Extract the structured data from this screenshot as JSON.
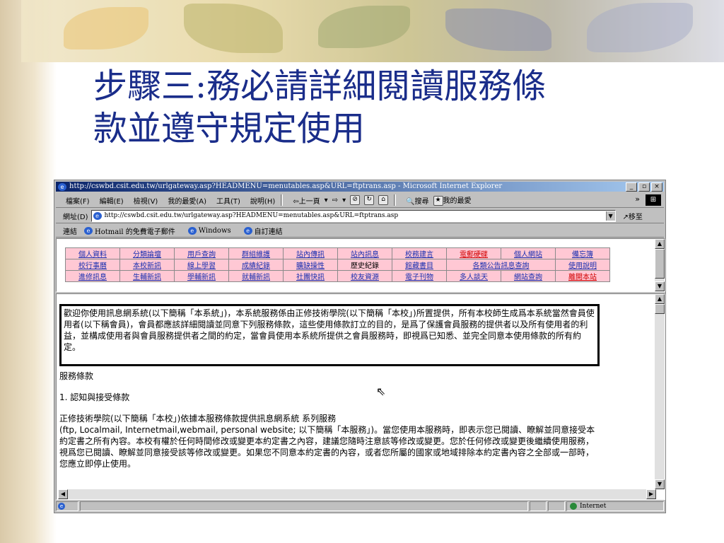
{
  "slide": {
    "title_line1": "步驟三:務必請詳細閱讀服務條",
    "title_line2": "款並遵守規定使用"
  },
  "browser": {
    "title": "http://cswbd.csit.edu.tw/urlgateway.asp?HEADMENU=menutables.asp&URL=ftptrans.asp - Microsoft Internet Explorer",
    "window_buttons": [
      "_",
      "▫",
      "×"
    ],
    "menu": [
      "檔案(F)",
      "編輯(E)",
      "檢視(V)",
      "我的最愛(A)",
      "工具(T)",
      "說明(H)"
    ],
    "toolbar": {
      "back": "⇦上一頁",
      "forward": "⇨",
      "search": "搜尋",
      "favorites": "我的最愛",
      "more": "»"
    },
    "address": {
      "label": "網址(D)",
      "url": "http://cswbd.csit.edu.tw/urlgateway.asp?HEADMENU=menutables.asp&URL=ftptrans.asp",
      "go": "移至"
    },
    "links": {
      "label": "連結",
      "items": [
        "Hotmail 的免費電子郵件",
        "Windows",
        "自訂連結"
      ]
    },
    "status": {
      "zone": "Internet"
    }
  },
  "nav": {
    "rows": [
      [
        "個人資料",
        "分類論壇",
        "用戶查詢",
        "群組維護",
        "站內傳訊",
        "站內訊息",
        "校務建言",
        "電郵硬碟",
        "個人網站",
        "備忘簿"
      ],
      [
        "校行事曆",
        "本校新訊",
        "線上學習",
        "成績紀錄",
        "曠缺操性",
        "歷史紀錄",
        "館藏書目",
        "各類公告訊息查詢",
        "",
        "使用說明"
      ],
      [
        "進修訊息",
        "生輔新訊",
        "學輔新訊",
        "就輔新訊",
        "社團快訊",
        "校友資源",
        "電子刊物",
        "多人談天",
        "網站查詢",
        "離開本站"
      ]
    ]
  },
  "content": {
    "notice": "歡迎你使用訊息網系統(以下簡稱「本系統」)，本系統服務係由正修技術學院(以下簡稱「本校」)所置提供，所有本校師生成爲本系統當然會員使用者(以下稱會員)，會員都應該詳細閱讀並同意下列服務條款，這些使用條款訂立的目的，是爲了保護會員服務的提供者以及所有使用者的利益，並構成使用者與會員服務提供者之間的約定，當會員使用本系統所提供之會員服務時，即視爲已知悉、並完全同意本使用條款的所有約定。",
    "terms_title": "服務條款",
    "section1": "1. 認知與接受條款",
    "para_intro": "正修技術學院(以下簡稱「本校」)依據本服務條款提供訊息網系統 系列服務",
    "para_body": "(ftp, Localmail, Internetmail,webmail, personal website; 以下簡稱「本服務」)。當您使用本服務時，即表示您已閱讀、瞭解並同意接受本約定書之所有內容。本校有權於任何時間修改或變更本約定書之內容，建議您隨時注意該等修改或變更。您於任何修改或變更後繼續使用服務，視爲您已閱讀、瞭解並同意接受該等修改或變更。如果您不同意本約定書的內容，或者您所屬的國家或地域排除本約定書內容之全部或一部時，您應立即停止使用。"
  }
}
